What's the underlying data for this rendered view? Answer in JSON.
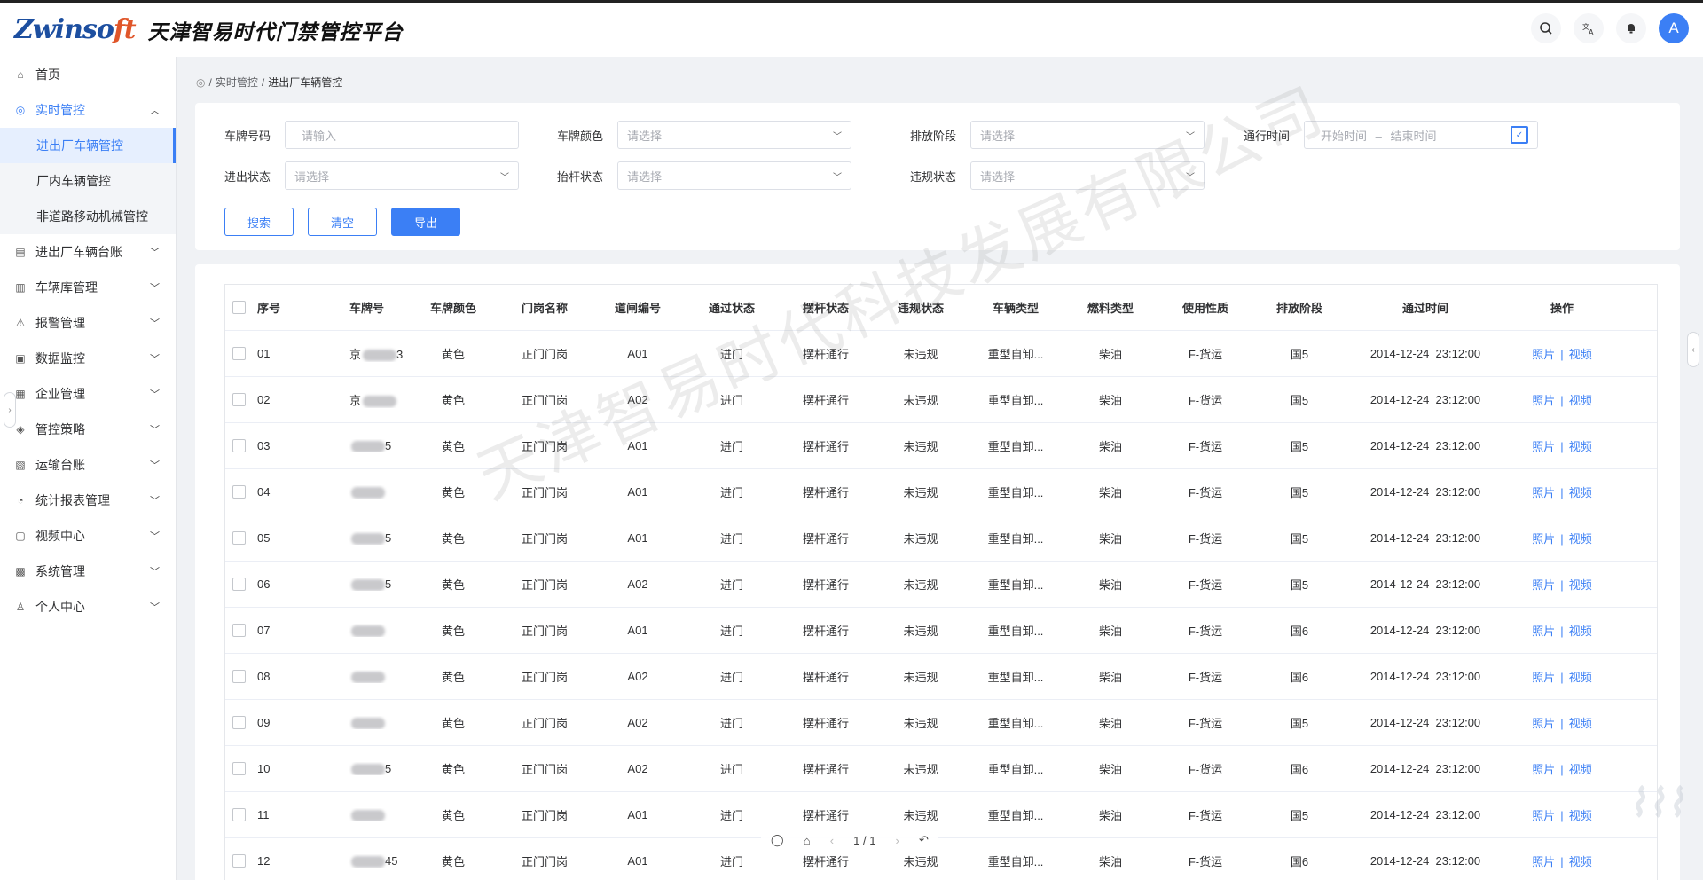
{
  "header": {
    "logo_text": "Zwinsoft",
    "title": "天津智易时代门禁管控平台",
    "avatar_letter": "A",
    "icons": [
      "search-icon",
      "translate-icon",
      "bell-icon"
    ]
  },
  "sidebar": {
    "items": [
      {
        "label": "首页",
        "icon": "home-icon"
      },
      {
        "label": "实时管控",
        "icon": "monitor-icon",
        "expanded": true
      },
      {
        "label": "进出厂车辆台账",
        "icon": "ledger-icon"
      },
      {
        "label": "车辆库管理",
        "icon": "doc-icon"
      },
      {
        "label": "报警管理",
        "icon": "alarm-icon"
      },
      {
        "label": "数据监控",
        "icon": "chart-icon"
      },
      {
        "label": "企业管理",
        "icon": "building-icon"
      },
      {
        "label": "管控策略",
        "icon": "shield-icon"
      },
      {
        "label": "运输台账",
        "icon": "truck-icon"
      },
      {
        "label": "统计报表管理",
        "icon": "gauge-icon"
      },
      {
        "label": "视频中心",
        "icon": "video-icon"
      },
      {
        "label": "系统管理",
        "icon": "grid-icon"
      },
      {
        "label": "个人中心",
        "icon": "user-icon"
      }
    ],
    "submenu": [
      {
        "label": "进出厂车辆管控",
        "active": true
      },
      {
        "label": "厂内车辆管控"
      },
      {
        "label": "非道路移动机械管控"
      }
    ]
  },
  "breadcrumb": {
    "parent": "实时管控",
    "current": "进出厂车辆管控"
  },
  "filters": {
    "plate_label": "车牌号码",
    "plate_placeholder": "请输入",
    "color_label": "车牌颜色",
    "color_value": "请选择",
    "stage_label": "排放阶段",
    "stage_value": "请选择",
    "time_label": "通行时间",
    "time_start": "开始时间",
    "time_sep": "–",
    "time_end": "结束时间",
    "inout_label": "进出状态",
    "inout_value": "请选择",
    "bar_label": "抬杆状态",
    "bar_value": "请选择",
    "violation_label": "违规状态",
    "violation_value": "请选择",
    "search_btn": "搜索",
    "clear_btn": "清空",
    "export_btn": "导出"
  },
  "table": {
    "headers": [
      "序号",
      "车牌号",
      "车牌颜色",
      "门岗名称",
      "道闸编号",
      "通过状态",
      "摆杆状态",
      "违规状态",
      "车辆类型",
      "燃料类型",
      "使用性质",
      "排放阶段",
      "通过时间",
      "操作"
    ],
    "rows": [
      {
        "no": "01",
        "plate": "京",
        "plate_tail": "3",
        "color": "黄色",
        "gate": "正门门岗",
        "lane": "A01",
        "pass": "进门",
        "bar": "摆杆通行",
        "vio": "未违规",
        "type": "重型自卸...",
        "fuel": "柴油",
        "use": "F-货运",
        "stage": "国5",
        "time": "2014-12-24  23:12:00"
      },
      {
        "no": "02",
        "plate": "京",
        "plate_tail": "",
        "color": "黄色",
        "gate": "正门门岗",
        "lane": "A02",
        "pass": "进门",
        "bar": "摆杆通行",
        "vio": "未违规",
        "type": "重型自卸...",
        "fuel": "柴油",
        "use": "F-货运",
        "stage": "国5",
        "time": "2014-12-24  23:12:00"
      },
      {
        "no": "03",
        "plate": "",
        "plate_tail": "5",
        "color": "黄色",
        "gate": "正门门岗",
        "lane": "A01",
        "pass": "进门",
        "bar": "摆杆通行",
        "vio": "未违规",
        "type": "重型自卸...",
        "fuel": "柴油",
        "use": "F-货运",
        "stage": "国5",
        "time": "2014-12-24  23:12:00"
      },
      {
        "no": "04",
        "plate": "",
        "plate_tail": "",
        "color": "黄色",
        "gate": "正门门岗",
        "lane": "A01",
        "pass": "进门",
        "bar": "摆杆通行",
        "vio": "未违规",
        "type": "重型自卸...",
        "fuel": "柴油",
        "use": "F-货运",
        "stage": "国5",
        "time": "2014-12-24  23:12:00"
      },
      {
        "no": "05",
        "plate": "",
        "plate_tail": "5",
        "color": "黄色",
        "gate": "正门门岗",
        "lane": "A01",
        "pass": "进门",
        "bar": "摆杆通行",
        "vio": "未违规",
        "type": "重型自卸...",
        "fuel": "柴油",
        "use": "F-货运",
        "stage": "国5",
        "time": "2014-12-24  23:12:00"
      },
      {
        "no": "06",
        "plate": "",
        "plate_tail": "5",
        "color": "黄色",
        "gate": "正门门岗",
        "lane": "A02",
        "pass": "进门",
        "bar": "摆杆通行",
        "vio": "未违规",
        "type": "重型自卸...",
        "fuel": "柴油",
        "use": "F-货运",
        "stage": "国5",
        "time": "2014-12-24  23:12:00"
      },
      {
        "no": "07",
        "plate": "",
        "plate_tail": "",
        "color": "黄色",
        "gate": "正门门岗",
        "lane": "A01",
        "pass": "进门",
        "bar": "摆杆通行",
        "vio": "未违规",
        "type": "重型自卸...",
        "fuel": "柴油",
        "use": "F-货运",
        "stage": "国6",
        "time": "2014-12-24  23:12:00"
      },
      {
        "no": "08",
        "plate": "",
        "plate_tail": "",
        "color": "黄色",
        "gate": "正门门岗",
        "lane": "A02",
        "pass": "进门",
        "bar": "摆杆通行",
        "vio": "未违规",
        "type": "重型自卸...",
        "fuel": "柴油",
        "use": "F-货运",
        "stage": "国6",
        "time": "2014-12-24  23:12:00"
      },
      {
        "no": "09",
        "plate": "",
        "plate_tail": "",
        "color": "黄色",
        "gate": "正门门岗",
        "lane": "A02",
        "pass": "进门",
        "bar": "摆杆通行",
        "vio": "未违规",
        "type": "重型自卸...",
        "fuel": "柴油",
        "use": "F-货运",
        "stage": "国5",
        "time": "2014-12-24  23:12:00"
      },
      {
        "no": "10",
        "plate": "",
        "plate_tail": "5",
        "color": "黄色",
        "gate": "正门门岗",
        "lane": "A02",
        "pass": "进门",
        "bar": "摆杆通行",
        "vio": "未违规",
        "type": "重型自卸...",
        "fuel": "柴油",
        "use": "F-货运",
        "stage": "国6",
        "time": "2014-12-24  23:12:00"
      },
      {
        "no": "11",
        "plate": "",
        "plate_tail": "",
        "color": "黄色",
        "gate": "正门门岗",
        "lane": "A01",
        "pass": "进门",
        "bar": "摆杆通行",
        "vio": "未违规",
        "type": "重型自卸...",
        "fuel": "柴油",
        "use": "F-货运",
        "stage": "国5",
        "time": "2014-12-24  23:12:00"
      },
      {
        "no": "12",
        "plate": "",
        "plate_tail": "45",
        "color": "黄色",
        "gate": "正门门岗",
        "lane": "A01",
        "pass": "进门",
        "bar": "摆杆通行",
        "vio": "未违规",
        "type": "重型自卸...",
        "fuel": "柴油",
        "use": "F-货运",
        "stage": "国6",
        "time": "2014-12-24  23:12:00"
      }
    ],
    "op_photo": "照片",
    "op_sep": "|",
    "op_video": "视频"
  },
  "watermark": "天津智易时代科技发展有限公司",
  "viewer": {
    "page": "1 / 1"
  },
  "colors": {
    "accent": "#3b7ff5",
    "sidebar_active_bg": "#e6effe"
  }
}
